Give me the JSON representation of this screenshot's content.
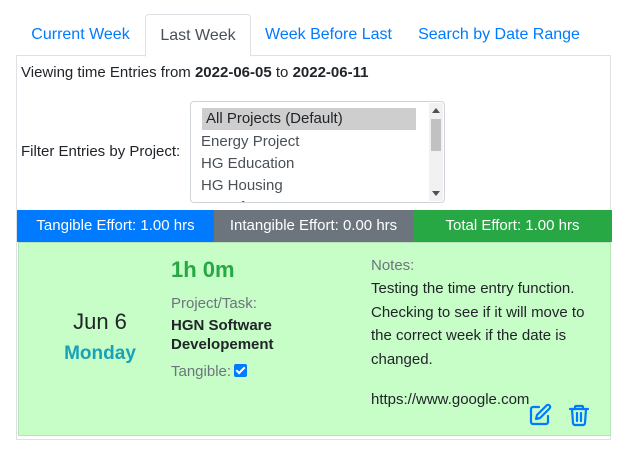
{
  "tabs": [
    {
      "label": "Current Week",
      "active": false
    },
    {
      "label": "Last Week",
      "active": true
    },
    {
      "label": "Week Before Last",
      "active": false
    },
    {
      "label": "Search by Date Range",
      "active": false
    }
  ],
  "viewing": {
    "prefix": "Viewing time Entries from",
    "from": "2022-06-05",
    "connector": "to",
    "to": "2022-06-11"
  },
  "filter": {
    "label": "Filter Entries by Project:",
    "options": [
      "All Projects (Default)",
      "Energy Project",
      "HG Education",
      "HG Housing",
      "HG Infrastructure"
    ],
    "selected": "All Projects (Default)"
  },
  "effort": {
    "tangible": "Tangible Effort: 1.00 hrs",
    "intangible": "Intangible Effort: 0.00 hrs",
    "total": "Total Effort: 1.00 hrs"
  },
  "entry": {
    "date": "Jun 6",
    "weekday": "Monday",
    "duration": "1h 0m",
    "project_label": "Project/Task:",
    "project_name": "HGN Software Developement",
    "tangible_label": "Tangible:",
    "tangible": true,
    "notes_label": "Notes:",
    "notes": "Testing the time entry function. Checking to see if it will move to the correct week if the date is changed.",
    "link": "https://www.google.com"
  },
  "colors": {
    "primary": "#007bff",
    "secondary": "#6c757d",
    "success": "#28a745",
    "info": "#17a2b8",
    "entry_bg": "#c7fdc7"
  },
  "icons": {
    "edit": "edit-icon",
    "delete": "trash-icon"
  }
}
